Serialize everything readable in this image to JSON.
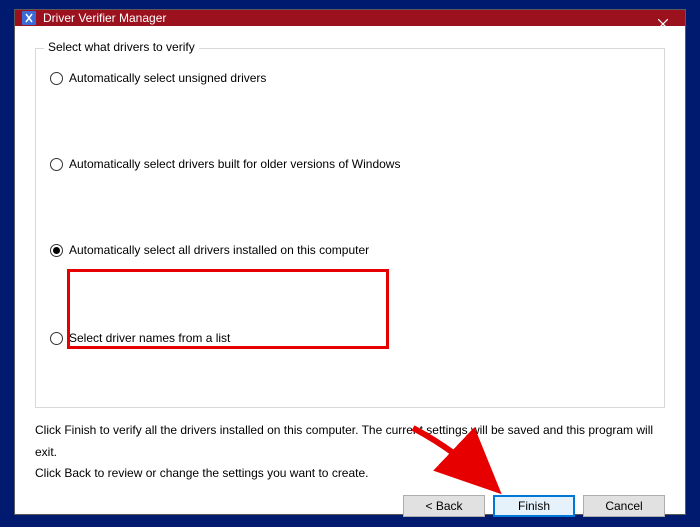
{
  "window": {
    "title": "Driver Verifier Manager"
  },
  "group": {
    "legend": "Select what drivers to verify",
    "options": {
      "opt1": "Automatically select unsigned drivers",
      "opt2": "Automatically select drivers built for older versions of Windows",
      "opt3": "Automatically select all drivers installed on this computer",
      "opt4": "Select driver names from a list"
    }
  },
  "help": {
    "line1": "Click Finish to verify all the drivers installed on this computer. The current settings will be saved and this program will exit.",
    "line2": "Click Back to review or change the settings you want to create."
  },
  "buttons": {
    "back": "< Back",
    "finish": "Finish",
    "cancel": "Cancel"
  }
}
